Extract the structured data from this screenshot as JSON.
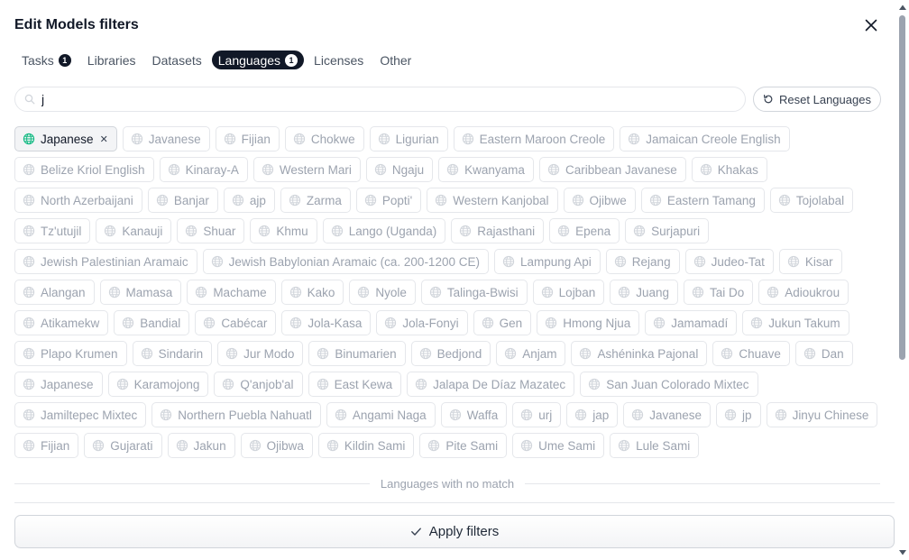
{
  "dialog": {
    "title": "Edit Models filters",
    "close_icon": "close-icon"
  },
  "tabs": [
    {
      "label": "Tasks",
      "badge": "1",
      "active": false
    },
    {
      "label": "Libraries",
      "badge": null,
      "active": false
    },
    {
      "label": "Datasets",
      "badge": null,
      "active": false
    },
    {
      "label": "Languages",
      "badge": "1",
      "active": true
    },
    {
      "label": "Licenses",
      "badge": null,
      "active": false
    },
    {
      "label": "Other",
      "badge": null,
      "active": false
    }
  ],
  "search": {
    "value": "j",
    "icon": "search-icon"
  },
  "reset_button": {
    "label": "Reset Languages",
    "icon": "reset-icon"
  },
  "languages": [
    {
      "label": "Japanese",
      "selected": true
    },
    {
      "label": "Javanese"
    },
    {
      "label": "Fijian"
    },
    {
      "label": "Chokwe"
    },
    {
      "label": "Ligurian"
    },
    {
      "label": "Eastern Maroon Creole"
    },
    {
      "label": "Jamaican Creole English"
    },
    {
      "label": "Belize Kriol English"
    },
    {
      "label": "Kinaray-A"
    },
    {
      "label": "Western Mari"
    },
    {
      "label": "Ngaju"
    },
    {
      "label": "Kwanyama"
    },
    {
      "label": "Caribbean Javanese"
    },
    {
      "label": "Khakas"
    },
    {
      "label": "North Azerbaijani"
    },
    {
      "label": "Banjar"
    },
    {
      "label": "ajp"
    },
    {
      "label": "Zarma"
    },
    {
      "label": "Popti'"
    },
    {
      "label": "Western Kanjobal"
    },
    {
      "label": "Ojibwe"
    },
    {
      "label": "Eastern Tamang"
    },
    {
      "label": "Tojolabal"
    },
    {
      "label": "Tz'utujil"
    },
    {
      "label": "Kanauji"
    },
    {
      "label": "Shuar"
    },
    {
      "label": "Khmu"
    },
    {
      "label": "Lango (Uganda)"
    },
    {
      "label": "Rajasthani"
    },
    {
      "label": "Epena"
    },
    {
      "label": "Surjapuri"
    },
    {
      "label": "Jewish Palestinian Aramaic"
    },
    {
      "label": "Jewish Babylonian Aramaic (ca. 200-1200 CE)"
    },
    {
      "label": "Lampung Api"
    },
    {
      "label": "Rejang"
    },
    {
      "label": "Judeo-Tat"
    },
    {
      "label": "Kisar"
    },
    {
      "label": "Alangan"
    },
    {
      "label": "Mamasa"
    },
    {
      "label": "Machame"
    },
    {
      "label": "Kako"
    },
    {
      "label": "Nyole"
    },
    {
      "label": "Talinga-Bwisi"
    },
    {
      "label": "Lojban"
    },
    {
      "label": "Juang"
    },
    {
      "label": "Tai Do"
    },
    {
      "label": "Adioukrou"
    },
    {
      "label": "Atikamekw"
    },
    {
      "label": "Bandial"
    },
    {
      "label": "Cabécar"
    },
    {
      "label": "Jola-Kasa"
    },
    {
      "label": "Jola-Fonyi"
    },
    {
      "label": "Gen"
    },
    {
      "label": "Hmong Njua"
    },
    {
      "label": "Jamamadí"
    },
    {
      "label": "Jukun Takum"
    },
    {
      "label": "Plapo Krumen"
    },
    {
      "label": "Sindarin"
    },
    {
      "label": "Jur Modo"
    },
    {
      "label": "Binumarien"
    },
    {
      "label": "Bedjond"
    },
    {
      "label": "Anjam"
    },
    {
      "label": "Ashéninka Pajonal"
    },
    {
      "label": "Chuave"
    },
    {
      "label": "Dan"
    },
    {
      "label": "Japanese"
    },
    {
      "label": "Karamojong"
    },
    {
      "label": "Q'anjob'al"
    },
    {
      "label": "East Kewa"
    },
    {
      "label": "Jalapa De Díaz Mazatec"
    },
    {
      "label": "San Juan Colorado Mixtec"
    },
    {
      "label": "Jamiltepec Mixtec"
    },
    {
      "label": "Northern Puebla Nahuatl"
    },
    {
      "label": "Angami Naga"
    },
    {
      "label": "Waffa"
    },
    {
      "label": "urj"
    },
    {
      "label": "jap"
    },
    {
      "label": "Javanese"
    },
    {
      "label": "jp"
    },
    {
      "label": "Jinyu Chinese"
    },
    {
      "label": "Fijian"
    },
    {
      "label": "Gujarati"
    },
    {
      "label": "Jakun"
    },
    {
      "label": "Ojibwa"
    },
    {
      "label": "Kildin Sami"
    },
    {
      "label": "Pite Sami"
    },
    {
      "label": "Ume Sami"
    },
    {
      "label": "Lule Sami"
    }
  ],
  "no_match_label": "Languages with no match",
  "apply_button": {
    "label": "Apply filters",
    "icon": "check-icon"
  },
  "colors": {
    "active_tab_bg": "#111827",
    "selected_chip_globe": "#10b981",
    "muted_text": "#9ca3af"
  }
}
